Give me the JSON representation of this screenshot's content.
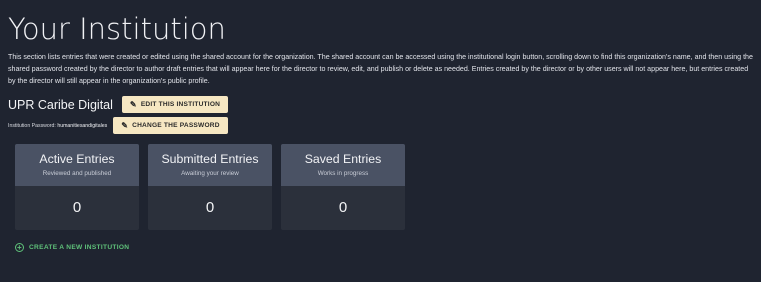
{
  "header": {
    "title": "Your Institution"
  },
  "intro": {
    "text": "This section lists entries that were created or edited using the shared account for the organization. The shared account can be accessed using the institutional login button, scrolling down to find this organization's name, and then using the shared password created by the director to author draft entries that will appear here for the director to review, edit, and publish or delete as needed. Entries created by the director or by other users will not appear here, but entries created by the director will still appear in the organization's public profile."
  },
  "institution": {
    "name": "UPR Caribe Digital",
    "edit_label": "EDIT THIS INSTITUTION",
    "password_label": "Institution Password:",
    "password_value": "humanitiesandigitales",
    "change_password_label": "CHANGE THE PASSWORD"
  },
  "cards": [
    {
      "title": "Active Entries",
      "subtitle": "Reviewed and published",
      "count": "0"
    },
    {
      "title": "Submitted Entries",
      "subtitle": "Awaiting your review",
      "count": "0"
    },
    {
      "title": "Saved Entries",
      "subtitle": "Works in progress",
      "count": "0"
    }
  ],
  "actions": {
    "create_label": "CREATE A NEW INSTITUTION"
  },
  "icons": {
    "edit": "pencil-icon",
    "create": "plus-circle-icon"
  },
  "colors": {
    "background": "#1f2430",
    "button": "#f6e7c2",
    "card_header": "#4a5264",
    "create_link": "#5fc27a"
  }
}
